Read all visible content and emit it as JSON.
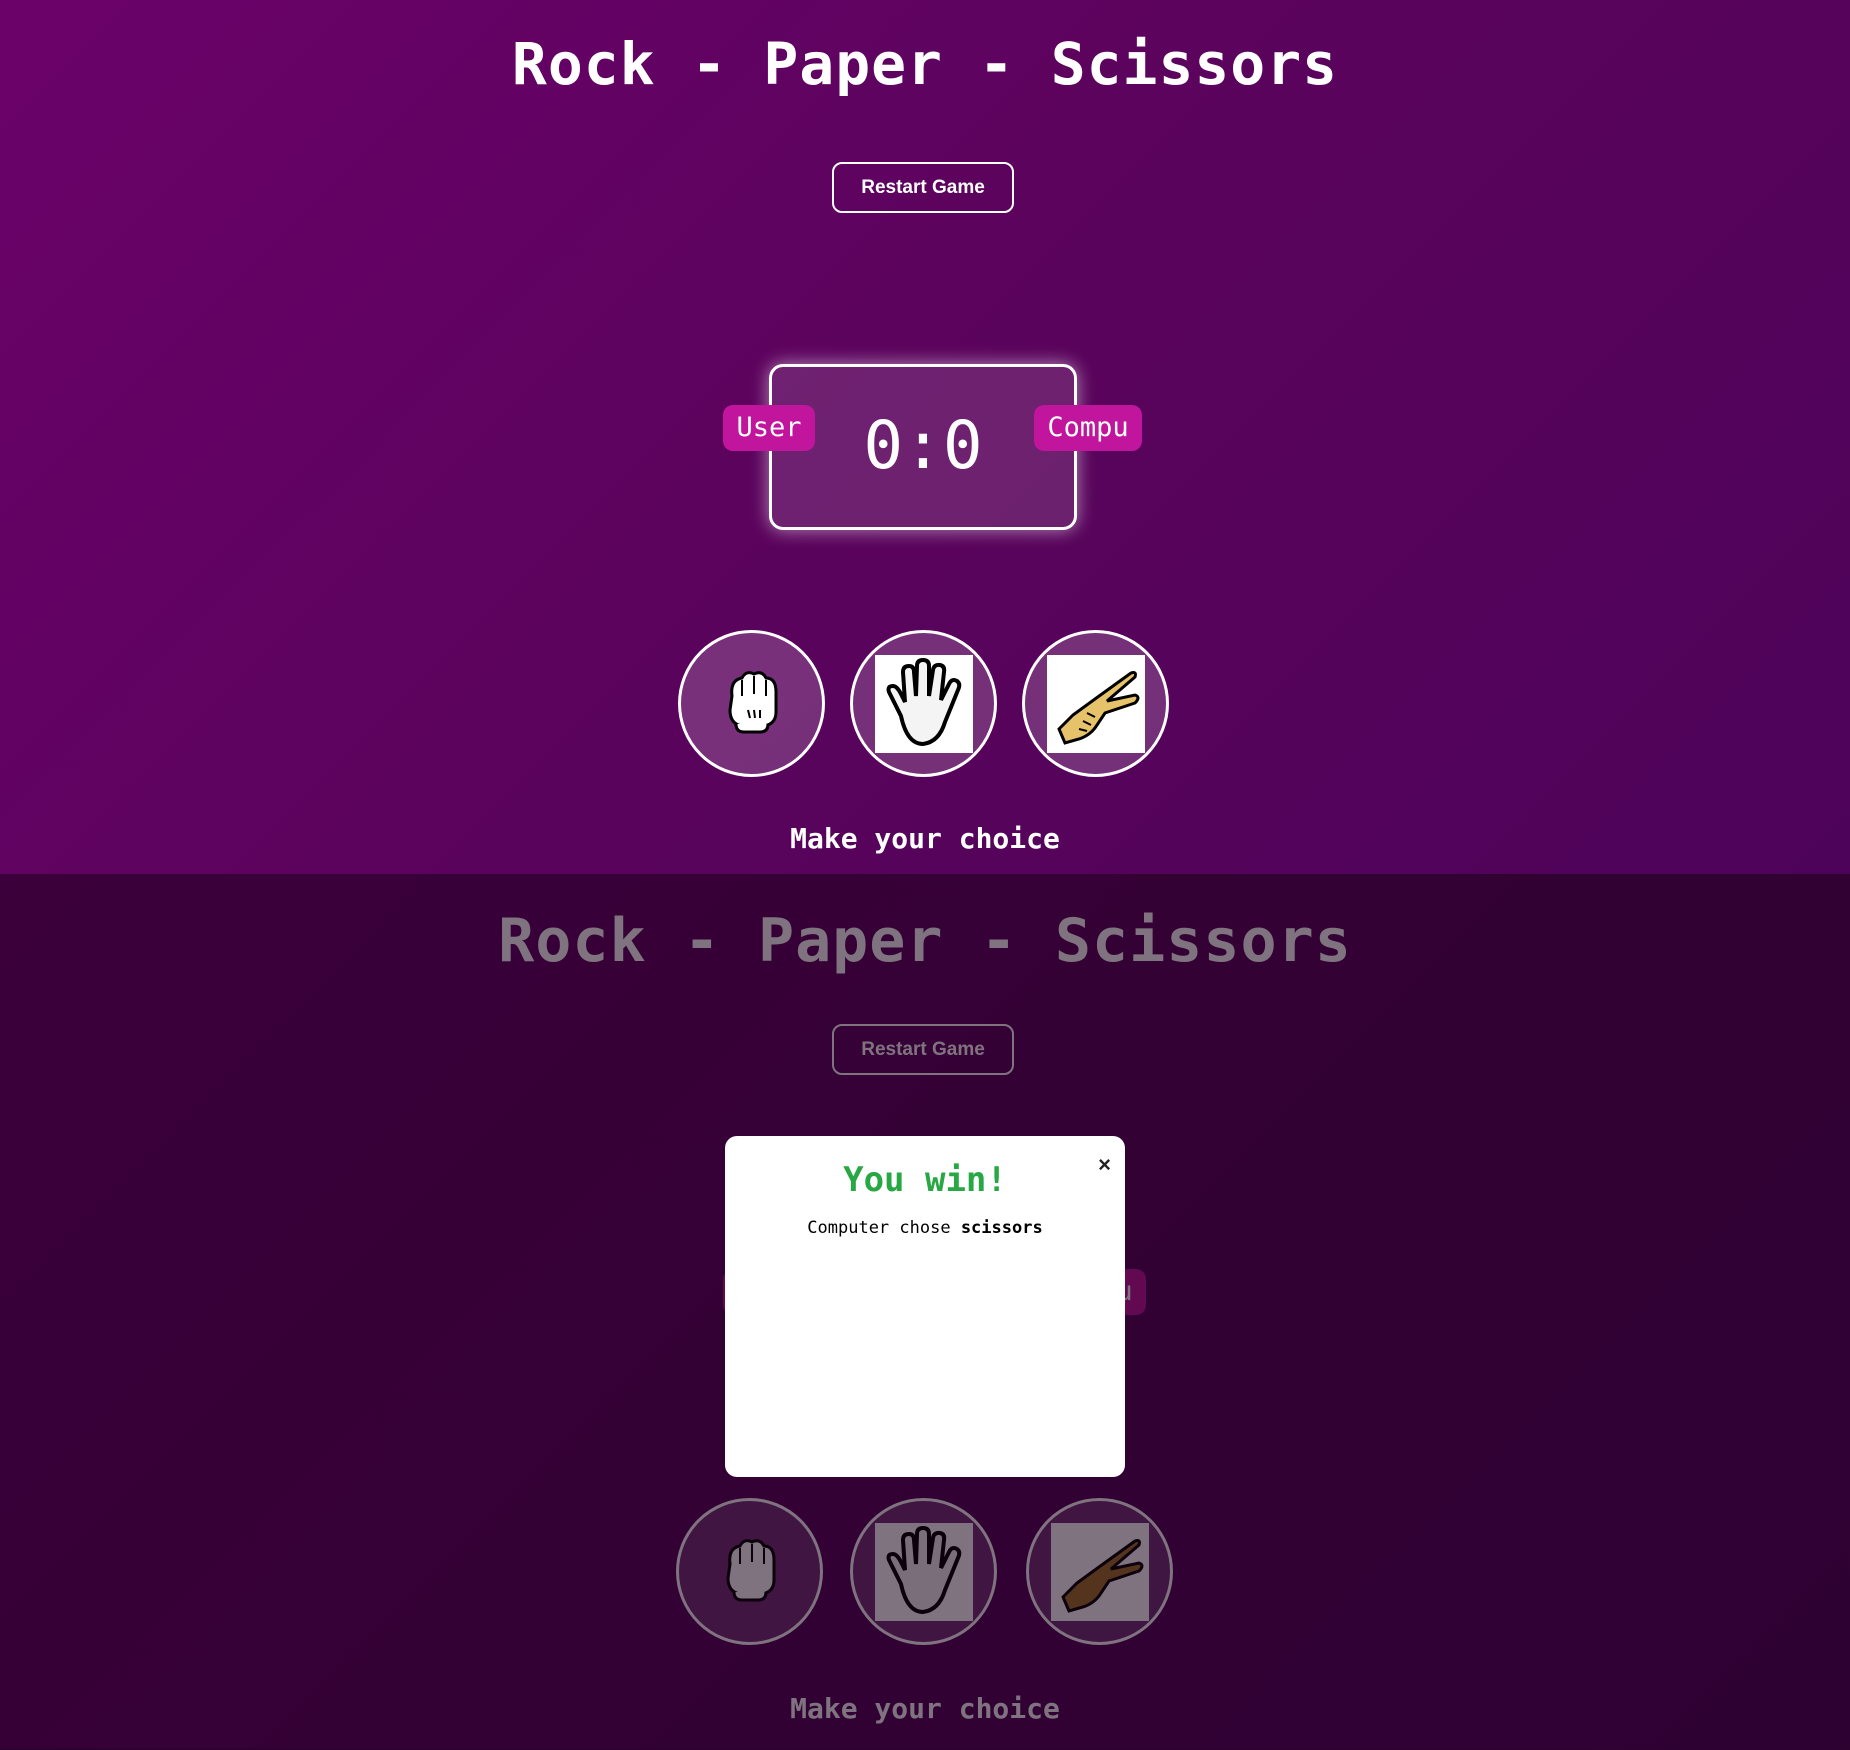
{
  "game": {
    "title": "Rock - Paper - Scissors",
    "restart_label": "Restart Game",
    "score_text": "0:0",
    "user_label": "User",
    "computer_label": "Compu",
    "prompt": "Make your choice",
    "choices": [
      {
        "name": "rock",
        "icon": "rock-fist-icon"
      },
      {
        "name": "paper",
        "icon": "paper-hand-icon"
      },
      {
        "name": "scissors",
        "icon": "scissors-hand-icon"
      }
    ]
  },
  "modal": {
    "close_label": "×",
    "result": "You win!",
    "detail_prefix": "Computer chose ",
    "computer_choice": "scissors"
  },
  "colors": {
    "background": "#6b026a",
    "badge": "#c0159c",
    "win": "#28a745"
  }
}
